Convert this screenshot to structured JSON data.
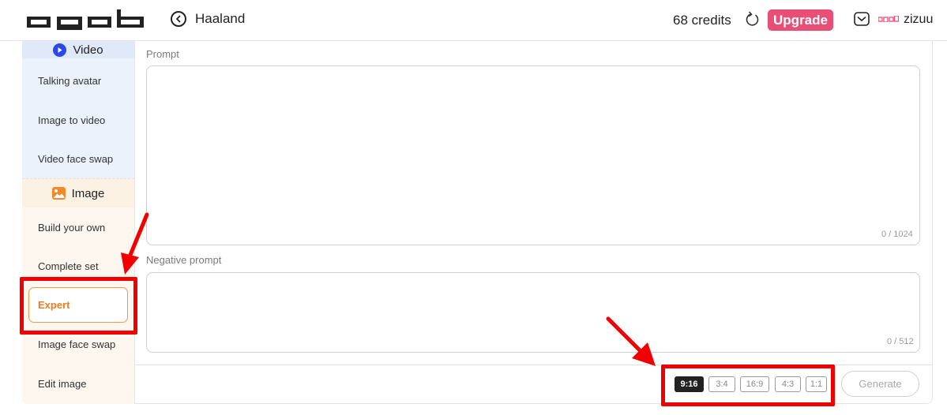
{
  "header": {
    "logo_alt": "apob",
    "back_title": "Haaland",
    "credits": "68 credits",
    "upgrade_label": "Upgrade",
    "username": "zizuu",
    "icons": [
      "back-circle-icon",
      "refresh-icon",
      "mail-icon"
    ]
  },
  "sidebar": {
    "video_section": {
      "title": "Video",
      "icon": "play-icon",
      "items": [
        "Talking avatar",
        "Image to video",
        "Video face swap"
      ]
    },
    "image_section": {
      "title": "Image",
      "icon": "image-icon",
      "items": [
        "Build your own",
        "Complete set",
        "Expert",
        "Image face swap",
        "Edit image"
      ],
      "active_item": "Expert"
    }
  },
  "main": {
    "prompt": {
      "label": "Prompt",
      "value": "",
      "placeholder": "",
      "counter": "0 / 1024"
    },
    "negative_prompt": {
      "label": "Negative prompt",
      "value": "",
      "placeholder": "",
      "counter": "0 / 512"
    },
    "aspect_ratios": [
      "9:16",
      "3:4",
      "16:9",
      "4:3",
      "1:1"
    ],
    "selected_ratio": "9:16",
    "generate_label": "Generate"
  },
  "colors": {
    "accent_pink": "#e94e77",
    "active_orange": "#f07c1f",
    "annotation_red": "#f20000",
    "video_bg": "#ebf2fc",
    "image_bg": "#fdf7ef"
  }
}
